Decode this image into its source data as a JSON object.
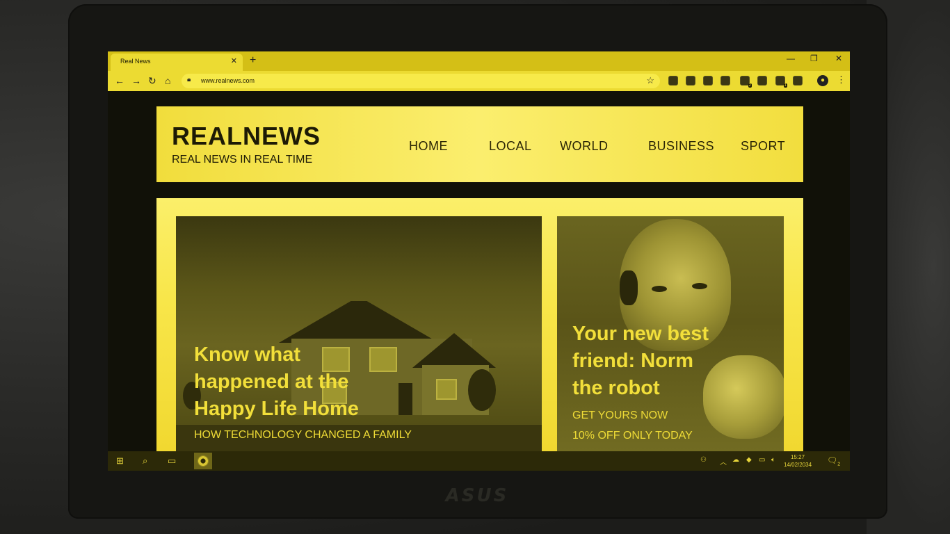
{
  "browser": {
    "tab_title": "Real News",
    "tab_close": "✕",
    "new_tab": "+",
    "url": "www.realnews.com",
    "window_controls": [
      "—",
      "❐",
      "✕"
    ],
    "nav_icons": [
      "back-icon",
      "forward-icon",
      "reload-icon",
      "home-icon"
    ],
    "extension_badges": [
      "2",
      "1"
    ]
  },
  "site": {
    "brand": "REALNEWS",
    "tagline": "REAL NEWS IN REAL TIME",
    "nav": [
      "HOME",
      "LOCAL",
      "WORLD",
      "BUSINESS",
      "SPORT"
    ]
  },
  "stories": {
    "left": {
      "headline_1": "Know what",
      "headline_2": "happened at the",
      "headline_3": "Happy Life Home",
      "subtitle": "HOW TECHNOLOGY CHANGED A FAMILY"
    },
    "right": {
      "headline_1": "Your new best",
      "headline_2": "friend: Norm",
      "headline_3": "the robot",
      "subtitle_1": "GET YOURS NOW",
      "subtitle_2": "10% OFF ONLY TODAY"
    }
  },
  "taskbar": {
    "time": "15:27",
    "date": "14/02/2034",
    "notification_count": "2"
  },
  "colors": {
    "tint": "#f1dd3c",
    "header_bg": "#fbee6e",
    "text_dark": "#1d1a05",
    "taskbar": "#2c2908"
  }
}
